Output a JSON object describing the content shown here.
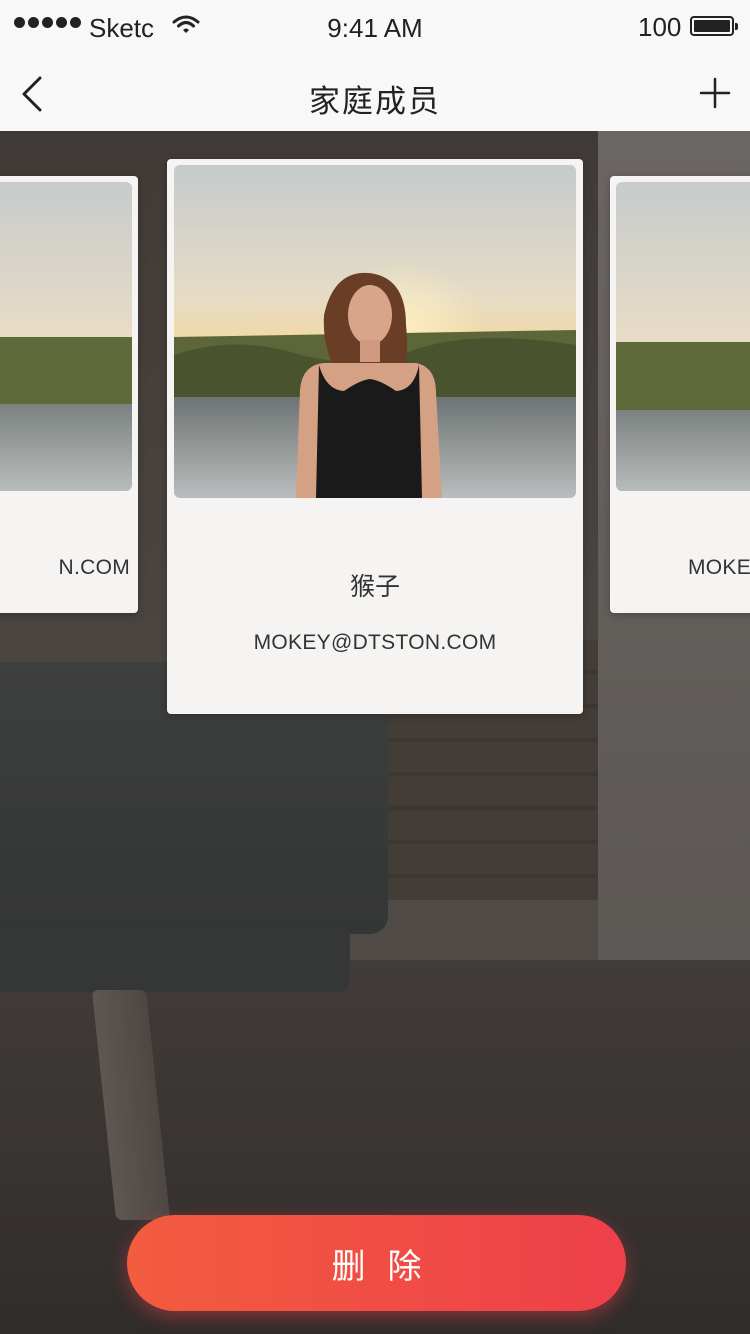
{
  "status_bar": {
    "carrier": "Sketc",
    "time": "9:41 AM",
    "battery_percent": "100",
    "wifi_icon": "wifi-icon",
    "battery_icon": "battery-icon"
  },
  "nav": {
    "title": "家庭成员",
    "back_icon": "chevron-left-icon",
    "add_icon": "plus-icon"
  },
  "members": {
    "previous": {
      "email": "N.COM"
    },
    "current": {
      "name": "猴子",
      "email": "MOKEY@DTSTON.COM"
    },
    "next": {
      "email": "MOKE"
    }
  },
  "actions": {
    "delete_label": "删除"
  },
  "colors": {
    "accent_start": "#f25c3f",
    "accent_end": "#ee3f4a",
    "nav_bg": "#f8f8f8",
    "card_bg": "#f5f4f2"
  }
}
